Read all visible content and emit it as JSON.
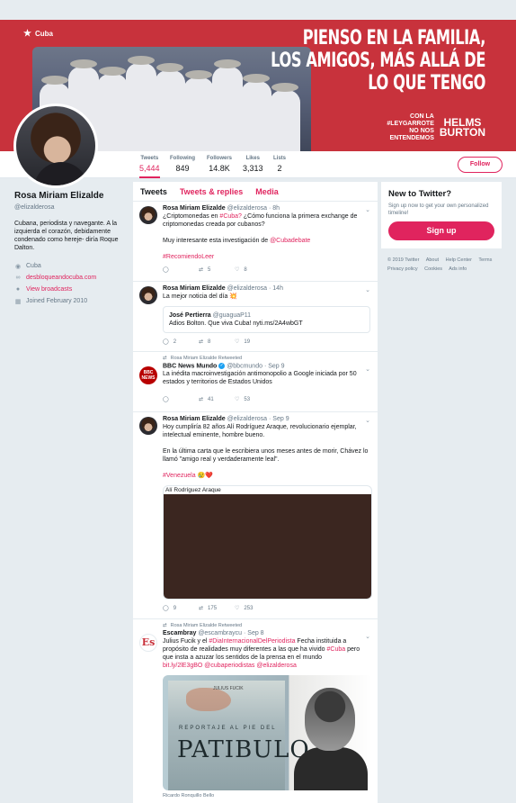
{
  "banner": {
    "brand": "Cuba",
    "headline": [
      "PIENSO EN LA FAMILIA,",
      "LOS AMIGOS, MÁS ALLÁ DE",
      "LO QUE TENGO"
    ],
    "tagline": [
      "CON LA",
      "#LEYGARROTE",
      "NO NOS",
      "ENTENDEMOS"
    ],
    "logo": [
      "HELMS",
      "BURTON"
    ]
  },
  "stats": [
    {
      "label": "Tweets",
      "value": "5,444"
    },
    {
      "label": "Following",
      "value": "849"
    },
    {
      "label": "Followers",
      "value": "14.8K"
    },
    {
      "label": "Likes",
      "value": "3,313"
    },
    {
      "label": "Lists",
      "value": "2"
    }
  ],
  "follow_label": "Follow",
  "profile": {
    "name": "Rosa Miriam Elizalde",
    "handle": "@elizalderosa",
    "bio": "Cubana, periodista y navegante. A la izquierda el corazón, debidamente condenado como hereje- diría Roque Dalton.",
    "location": "Cuba",
    "website": "desbloqueandocuba.com",
    "broadcasts": "View broadcasts",
    "joined": "Joined February 2010"
  },
  "tabs": [
    "Tweets",
    "Tweets & replies",
    "Media"
  ],
  "tweets": [
    {
      "author": "Rosa Miriam Elizalde",
      "handle": "@elizalderosa",
      "time": "· 8h",
      "text_a": "¿Criptomonedas en ",
      "text_a_tag": "#Cuba?",
      "text_a_rest": " ¿Cómo funciona la primera exchange de criptomonedas creada por cubanos?",
      "text_b": "Muy interesante esta investigación de ",
      "text_b_tag": "@Cubadebate",
      "text_c": "#RecomiendoLeer",
      "retweets": "5",
      "likes": "8"
    },
    {
      "author": "Rosa Miriam Elizalde",
      "handle": "@elizalderosa",
      "time": "· 14h",
      "text": "La mejor noticia del día 💥",
      "quote_name": "José Pertierra",
      "quote_handle": "@guaguaP11",
      "quote_text": "Adios Bolton. Que viva Cuba! nyti.ms/2A4wbGT",
      "replies": "2",
      "retweets": "8",
      "likes": "19"
    },
    {
      "rt_by": "Rosa Miriam Elizalde Retweeted",
      "author": "BBC News Mundo",
      "handle": "@bbcmundo",
      "time": "· Sep 9",
      "avatar_text": "BBC NEWS",
      "text": "La inédita macroinvestigación antimonopolio a Google iniciada por 50 estados y territorios de Estados Unidos",
      "retweets": "41",
      "likes": "53"
    },
    {
      "author": "Rosa Miriam Elizalde",
      "handle": "@elizalderosa",
      "time": "· Sep 9",
      "text_a": "Hoy cumpliría 82 años Alí Rodríguez Araque, revolucionario ejemplar, intelectual eminente, hombre bueno.",
      "text_b": "En la última carta que le escribiera unos meses antes de morir, Chávez  lo llamó \"amigo real y verdaderamente leal\".",
      "text_c": "#Venezuela",
      "text_c_emoji": " 😢❤️",
      "media_alt": "Alí Rodríguez Araque",
      "replies": "9",
      "retweets": "175",
      "likes": "253"
    },
    {
      "rt_by": "Rosa Miriam Elizalde Retweeted",
      "author": "Escambray",
      "handle": "@escambraycu",
      "time": "· Sep 8",
      "avatar_text": "Es",
      "text_a": "Julius Fucik y el ",
      "text_a_tag": "#DiaInternacionalDelPeriodista",
      "text_a_rest": " Fecha instituida a propósito de realidades muy diferentes a las que ha vivido ",
      "text_a_tag2": "#Cuba",
      "text_a_rest2": " pero que insta a azuzar los sentidos de la prensa en el mundo",
      "links": "bit.ly/2lE3gBO @cubaperiodistas @elizalderosa",
      "book_title": "PATIBULO",
      "book_sub": "REPORTAJE AL PIE DEL",
      "book_author": "JULIUS FUCIK",
      "caption": "Ricardo Ronquillo Bello"
    }
  ],
  "signup": {
    "title": "New to Twitter?",
    "subtitle": "Sign up now to get your own personalized timeline!",
    "button": "Sign up"
  },
  "footer": [
    "© 2019 Twitter",
    "About",
    "Help Center",
    "Terms",
    "Privacy policy",
    "Cookies",
    "Ads info"
  ],
  "colors": {
    "accent": "#e0245e",
    "banner": "#c8323c"
  }
}
